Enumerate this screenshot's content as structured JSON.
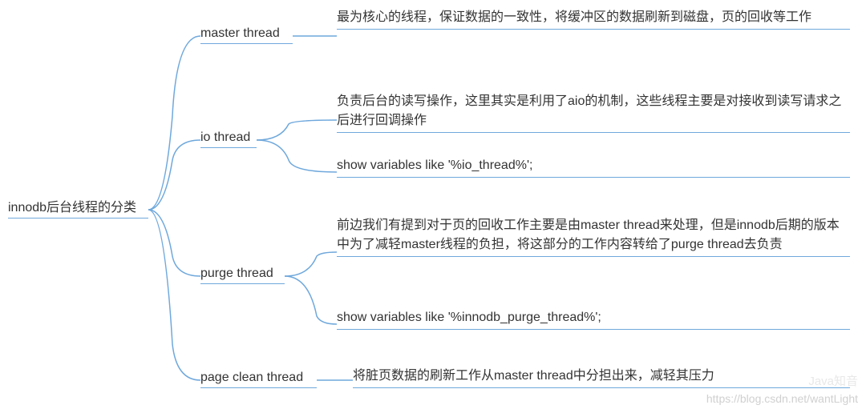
{
  "root": {
    "label": "innodb后台线程的分类"
  },
  "branches": [
    {
      "label": "master thread",
      "leaves": [
        {
          "text": "最为核心的线程，保证数据的一致性，将缓冲区的数据刷新到磁盘，页的回收等工作"
        }
      ]
    },
    {
      "label": "io thread",
      "leaves": [
        {
          "text": "负责后台的读写操作，这里其实是利用了aio的机制，这些线程主要是对接收到读写请求之后进行回调操作"
        },
        {
          "text": "show variables like '%io_thread%';"
        }
      ]
    },
    {
      "label": "purge thread",
      "leaves": [
        {
          "text": "前边我们有提到对于页的回收工作主要是由master thread来处理，但是innodb后期的版本中为了减轻master线程的负担，将这部分的工作内容转给了purge thread去负责"
        },
        {
          "text": "show variables like '%innodb_purge_thread%';"
        }
      ]
    },
    {
      "label": "page clean thread",
      "leaves": [
        {
          "text": "将脏页数据的刷新工作从master thread中分担出来，减轻其压力"
        }
      ]
    }
  ],
  "watermark": {
    "brand": "Java知音",
    "url": "https://blog.csdn.net/wantLight"
  },
  "color": "#6fa8dc"
}
